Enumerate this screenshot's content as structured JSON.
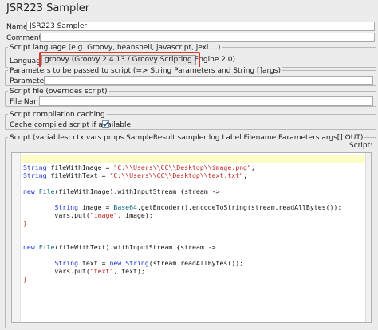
{
  "title": "JSR223 Sampler",
  "name": {
    "label": "Name:",
    "value": "JSR223 Sampler"
  },
  "comments": {
    "label": "Comments:"
  },
  "script_language": {
    "legend": "Script language (e.g. Groovy, beanshell, javascript, jexl ...)",
    "label": "Language:",
    "selected": "groovy      (Groovy 2.4.13 / Groovy Scripting Engine 2.0)"
  },
  "parameters": {
    "legend": "Parameters to be passed to script (=> String Parameters and String []args)",
    "label": "Parameters:"
  },
  "script_file": {
    "legend": "Script file (overrides script)",
    "label": "File Name:"
  },
  "caching": {
    "legend": "Script compilation caching",
    "label": "Cache compiled script if available:",
    "checked": true
  },
  "script": {
    "legend": "Script (variables: ctx vars props SampleResult sampler log Label Filename Parameters args[] OUT)",
    "header": "Script:",
    "lines": [
      "",
      "String fileWithImage = \"C:\\\\Users\\\\CC\\\\Desktop\\\\image.png\";",
      "String fileWithText = \"C:\\\\Users\\\\CC\\\\Desktop\\\\text.txt\";",
      "",
      "new File(fileWithImage).withInputStream {stream ->",
      "",
      "        String image = Base64.getEncoder().encodeToString(stream.readAllBytes());",
      "        vars.put(\"image\", image);",
      "}",
      "",
      "",
      "new File(fileWithText).withInputStream {stream ->",
      "",
      "        String text = new String(stream.readAllBytes());",
      "        vars.put(\"text\", text);",
      "}"
    ]
  }
}
